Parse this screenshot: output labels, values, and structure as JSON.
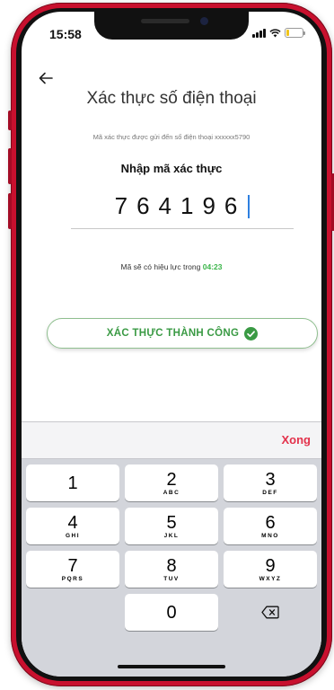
{
  "status_bar": {
    "time": "15:58"
  },
  "header": {
    "title": "Xác thực số điện thoại",
    "subtitle": "Mã xác thực được gửi đến số điện thoại xxxxxx5790"
  },
  "code_entry": {
    "label": "Nhập mã xác thực",
    "value": "764196"
  },
  "countdown": {
    "prefix": "Mã sẽ có hiệu lực trong",
    "time": "04:23"
  },
  "verify_button": {
    "label": "XÁC THỰC THÀNH CÔNG"
  },
  "keyboard": {
    "done_label": "Xong",
    "keys": [
      {
        "digit": "1",
        "letters": ""
      },
      {
        "digit": "2",
        "letters": "ABC"
      },
      {
        "digit": "3",
        "letters": "DEF"
      },
      {
        "digit": "4",
        "letters": "GHI"
      },
      {
        "digit": "5",
        "letters": "JKL"
      },
      {
        "digit": "6",
        "letters": "MNO"
      },
      {
        "digit": "7",
        "letters": "PQRS"
      },
      {
        "digit": "8",
        "letters": "TUV"
      },
      {
        "digit": "9",
        "letters": "WXYZ"
      },
      {
        "digit": "0",
        "letters": ""
      }
    ]
  },
  "colors": {
    "phone_frame": "#c8102e",
    "success_green": "#3a9a44",
    "timer_green": "#3bb54a",
    "done_red": "#e3314b",
    "caret_blue": "#2d7fe0"
  },
  "icons": {
    "back": "arrow-left-icon",
    "success": "check-circle-icon",
    "delete": "backspace-icon"
  }
}
